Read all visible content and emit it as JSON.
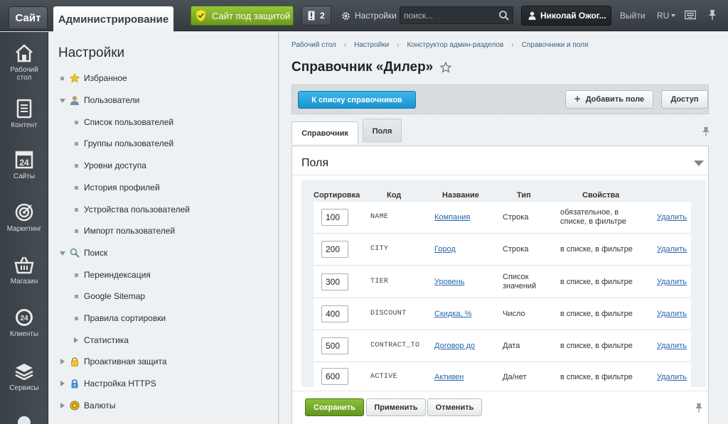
{
  "topbar": {
    "site_tab": "Сайт",
    "admin_tab": "Администрирование",
    "secure_label": "Сайт под защитой",
    "notifications_count": "2",
    "settings_label": "Настройки",
    "search_placeholder": "поиск...",
    "user_name": "Николай Ожог...",
    "logout_label": "Выйти",
    "language": "RU"
  },
  "leftnav": [
    {
      "label": "Рабочий стол",
      "icon": "home-icon"
    },
    {
      "label": "Контент",
      "icon": "document-icon"
    },
    {
      "label": "Сайты",
      "icon": "calendar-icon"
    },
    {
      "label": "Маркетинг",
      "icon": "target-icon"
    },
    {
      "label": "Магазин",
      "icon": "basket-icon"
    },
    {
      "label": "Клиенты",
      "icon": "clients-icon"
    },
    {
      "label": "Сервисы",
      "icon": "layers-icon"
    }
  ],
  "calendar_day": "24",
  "clients_badge": "24",
  "menu": {
    "title": "Настройки",
    "items": [
      {
        "label": "Избранное"
      },
      {
        "label": "Пользователи"
      },
      {
        "label": "Список пользователей"
      },
      {
        "label": "Группы пользователей"
      },
      {
        "label": "Уровни доступа"
      },
      {
        "label": "История профилей"
      },
      {
        "label": "Устройства пользователей"
      },
      {
        "label": "Импорт пользователей"
      },
      {
        "label": "Поиск"
      },
      {
        "label": "Переиндексация"
      },
      {
        "label": "Google Sitemap"
      },
      {
        "label": "Правила сортировки"
      },
      {
        "label": "Статистика"
      },
      {
        "label": "Проактивная защита"
      },
      {
        "label": "Настройка HTTPS"
      },
      {
        "label": "Валюты"
      }
    ]
  },
  "breadcrumbs": [
    "Рабочий стол",
    "Настройки",
    "Конструктор админ-разделов",
    "Справочники и поля"
  ],
  "page_title": "Справочник «Дилер»",
  "toolbar": {
    "back_label": "К списку справочников",
    "add_field_label": "Добавить поле",
    "access_label": "Доступ"
  },
  "tabs": [
    "Справочник",
    "Поля"
  ],
  "active_tab": "Поля",
  "panel_title": "Поля",
  "table": {
    "headers": [
      "Сортировка",
      "Код",
      "Название",
      "Тип",
      "Свойства"
    ],
    "rows": [
      {
        "sort": "100",
        "code": "NAME",
        "name": "Компания",
        "type": "Строка",
        "props": "обязательное, в списке, в фильтре",
        "action": "Удалить"
      },
      {
        "sort": "200",
        "code": "CITY",
        "name": "Город",
        "type": "Строка",
        "props": "в списке, в фильтре",
        "action": "Удалить"
      },
      {
        "sort": "300",
        "code": "TIER",
        "name": "Уровень",
        "type": "Список значений",
        "props": "в списке, в фильтре",
        "action": "Удалить"
      },
      {
        "sort": "400",
        "code": "DISCOUNT",
        "name": "Скидка, %",
        "type": "Число",
        "props": "в списке, в фильтре",
        "action": "Удалить"
      },
      {
        "sort": "500",
        "code": "CONTRACT_TO",
        "name": "Договор до",
        "type": "Дата",
        "props": "в списке, в фильтре",
        "action": "Удалить"
      },
      {
        "sort": "600",
        "code": "ACTIVE",
        "name": "Активен",
        "type": "Да/нет",
        "props": "в списке, в фильтре",
        "action": "Удалить"
      }
    ]
  },
  "footer": {
    "save_label": "Сохранить",
    "apply_label": "Применить",
    "cancel_label": "Отменить"
  },
  "colors": {
    "accent_green": "#6b9a1a",
    "accent_blue": "#1a93cf",
    "link": "#2567a9",
    "dark_bar": "#353b40"
  }
}
